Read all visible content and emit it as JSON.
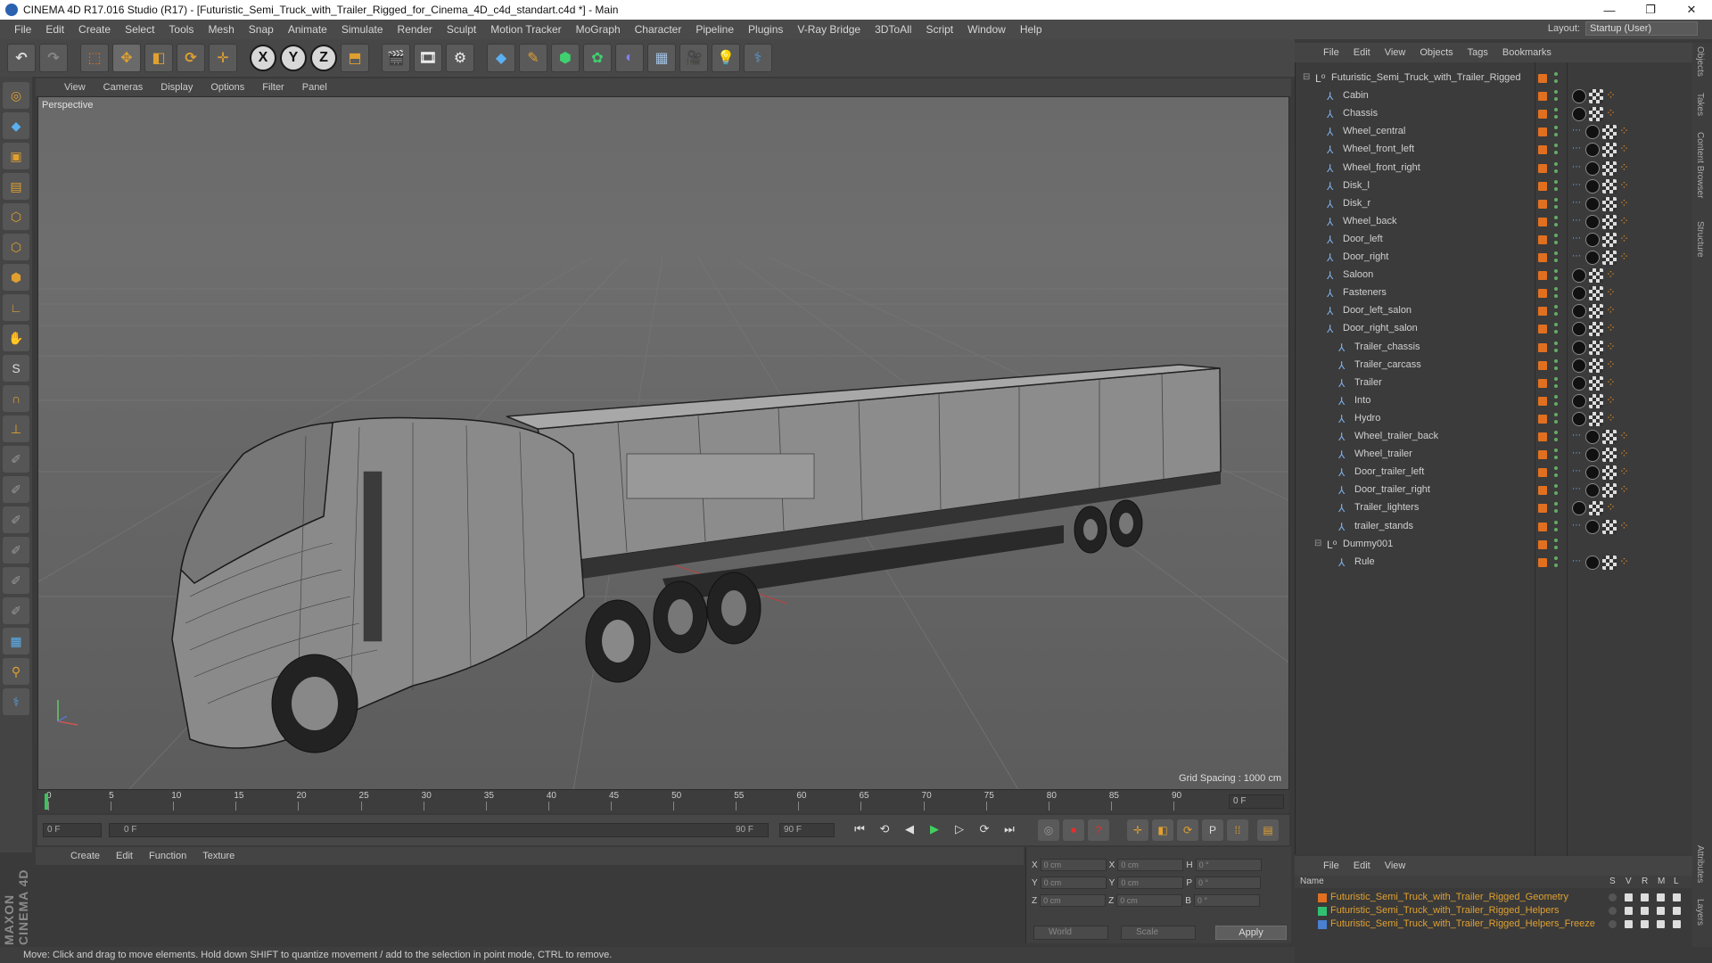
{
  "window": {
    "title": "CINEMA 4D R17.016 Studio (R17) - [Futuristic_Semi_Truck_with_Trailer_Rigged_for_Cinema_4D_c4d_standart.c4d *] - Main",
    "controls": [
      "—",
      "❐",
      "✕"
    ]
  },
  "menu": [
    "File",
    "Edit",
    "Create",
    "Select",
    "Tools",
    "Mesh",
    "Snap",
    "Animate",
    "Simulate",
    "Render",
    "Sculpt",
    "Motion Tracker",
    "MoGraph",
    "Character",
    "Pipeline",
    "Plugins",
    "V-Ray Bridge",
    "3DToAll",
    "Script",
    "Window",
    "Help"
  ],
  "layout": {
    "label": "Layout:",
    "value": "Startup (User)"
  },
  "toolbar": {
    "axis_x": "X",
    "axis_y": "Y",
    "axis_z": "Z"
  },
  "viewport": {
    "menu": [
      "View",
      "Cameras",
      "Display",
      "Options",
      "Filter",
      "Panel"
    ],
    "label": "Perspective",
    "grid_spacing": "Grid Spacing : 1000 cm"
  },
  "timeline": {
    "ticks": [
      "0",
      "5",
      "10",
      "15",
      "20",
      "25",
      "30",
      "35",
      "40",
      "45",
      "50",
      "55",
      "60",
      "65",
      "70",
      "75",
      "80",
      "85",
      "90"
    ],
    "current_frame": "0 F",
    "start_field": "0 F",
    "range_start": "0 F",
    "range_end": "90 F",
    "end_field": "90 F"
  },
  "material_menu": [
    "Create",
    "Edit",
    "Function",
    "Texture"
  ],
  "coords": {
    "rows": [
      {
        "a": "X",
        "av": "0 cm",
        "b": "X",
        "bv": "0 cm",
        "c": "H",
        "cv": "0 °"
      },
      {
        "a": "Y",
        "av": "0 cm",
        "b": "Y",
        "bv": "0 cm",
        "c": "P",
        "cv": "0 °"
      },
      {
        "a": "Z",
        "av": "0 cm",
        "b": "Z",
        "bv": "0 cm",
        "c": "B",
        "cv": "0 °"
      }
    ],
    "world": "World",
    "scale": "Scale",
    "apply": "Apply"
  },
  "status": "Move: Click and drag to move elements. Hold down SHIFT to quantize movement / add to the selection in point mode, CTRL to remove.",
  "objects_menu": [
    "File",
    "Edit",
    "View",
    "Objects",
    "Tags",
    "Bookmarks"
  ],
  "objects": [
    {
      "name": "Futuristic_Semi_Truck_with_Trailer_Rigged",
      "level": 0,
      "icon": "null"
    },
    {
      "name": "Cabin",
      "level": 1,
      "icon": "joint"
    },
    {
      "name": "Chassis",
      "level": 1,
      "icon": "joint"
    },
    {
      "name": "Wheel_central",
      "level": 1,
      "icon": "joint"
    },
    {
      "name": "Wheel_front_left",
      "level": 1,
      "icon": "joint"
    },
    {
      "name": "Wheel_front_right",
      "level": 1,
      "icon": "joint"
    },
    {
      "name": "Disk_l",
      "level": 1,
      "icon": "joint"
    },
    {
      "name": "Disk_r",
      "level": 1,
      "icon": "joint"
    },
    {
      "name": "Wheel_back",
      "level": 1,
      "icon": "joint"
    },
    {
      "name": "Door_left",
      "level": 1,
      "icon": "joint"
    },
    {
      "name": "Door_right",
      "level": 1,
      "icon": "joint"
    },
    {
      "name": "Saloon",
      "level": 1,
      "icon": "joint"
    },
    {
      "name": "Fasteners",
      "level": 1,
      "icon": "joint"
    },
    {
      "name": "Door_left_salon",
      "level": 1,
      "icon": "joint"
    },
    {
      "name": "Door_right_salon",
      "level": 1,
      "icon": "joint"
    },
    {
      "name": "Trailer_chassis",
      "level": 2,
      "icon": "joint"
    },
    {
      "name": "Trailer_carcass",
      "level": 2,
      "icon": "joint"
    },
    {
      "name": "Trailer",
      "level": 2,
      "icon": "joint"
    },
    {
      "name": "Into",
      "level": 2,
      "icon": "joint"
    },
    {
      "name": "Hydro",
      "level": 2,
      "icon": "joint"
    },
    {
      "name": "Wheel_trailer_back",
      "level": 2,
      "icon": "joint"
    },
    {
      "name": "Wheel_trailer",
      "level": 2,
      "icon": "joint"
    },
    {
      "name": "Door_trailer_left",
      "level": 2,
      "icon": "joint"
    },
    {
      "name": "Door_trailer_right",
      "level": 2,
      "icon": "joint"
    },
    {
      "name": "Trailer_lighters",
      "level": 2,
      "icon": "joint"
    },
    {
      "name": "trailer_stands",
      "level": 2,
      "icon": "joint"
    },
    {
      "name": "Dummy001",
      "level": 1,
      "icon": "null"
    },
    {
      "name": "Rule",
      "level": 2,
      "icon": "joint"
    }
  ],
  "layers_menu": [
    "File",
    "Edit",
    "View"
  ],
  "layers_header": {
    "name": "Name",
    "cols": [
      "S",
      "V",
      "R",
      "M",
      "L"
    ]
  },
  "layers": [
    {
      "name": "Futuristic_Semi_Truck_with_Trailer_Rigged_Geometry",
      "color": "#e07020"
    },
    {
      "name": "Futuristic_Semi_Truck_with_Trailer_Rigged_Helpers",
      "color": "#30c070"
    },
    {
      "name": "Futuristic_Semi_Truck_with_Trailer_Rigged_Helpers_Freeze",
      "color": "#4a80d0"
    }
  ],
  "right_tabs": [
    "Objects",
    "Takes",
    "Content Browser",
    "Structure",
    "Attributes",
    "Layers"
  ],
  "maxon": "MAXON CINEMA 4D",
  "colors": {
    "accent": "#e07020",
    "joint": "#7fb0e8"
  }
}
